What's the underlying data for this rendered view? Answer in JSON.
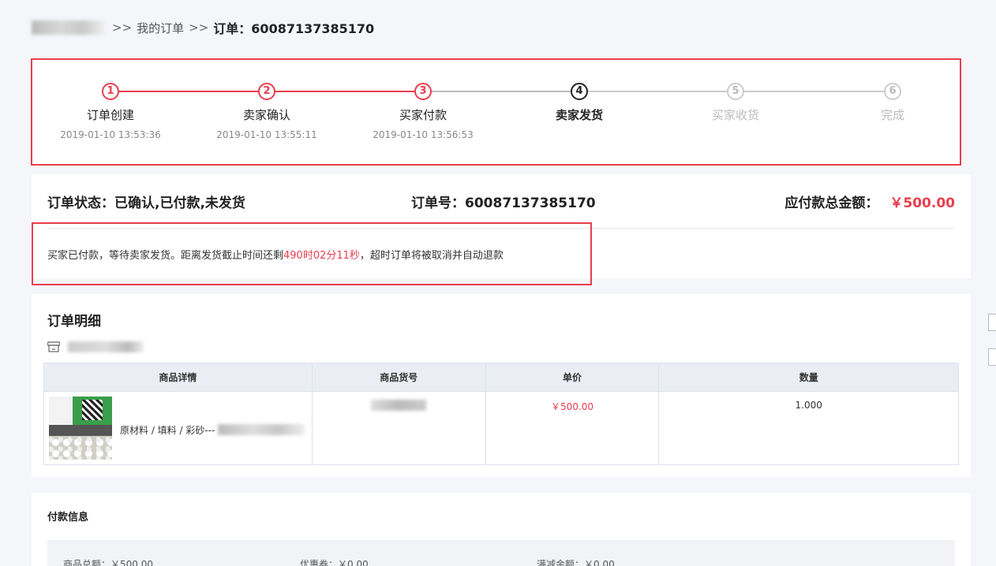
{
  "breadcrumb": {
    "my_orders": "我的订单",
    "sep": ">>",
    "current": "订单：60087137385170"
  },
  "steps": [
    {
      "num": "1",
      "label": "订单创建",
      "time": "2019-01-10 13:53:36",
      "state": "done"
    },
    {
      "num": "2",
      "label": "卖家确认",
      "time": "2019-01-10 13:55:11",
      "state": "done"
    },
    {
      "num": "3",
      "label": "买家付款",
      "time": "2019-01-10 13:56:53",
      "state": "done"
    },
    {
      "num": "4",
      "label": "卖家发货",
      "time": "",
      "state": "current"
    },
    {
      "num": "5",
      "label": "买家收货",
      "time": "",
      "state": "todo"
    },
    {
      "num": "6",
      "label": "完成",
      "time": "",
      "state": "todo"
    }
  ],
  "status": {
    "order_status": "订单状态：已确认,已付款,未发货",
    "order_no": "订单号：60087137385170",
    "total_label": "应付款总金额：",
    "total_amount": "￥500.00",
    "notice_prefix": "买家已付款，等待卖家发货。距离发货截止时间还剩",
    "countdown": "490时02分11秒",
    "notice_suffix": "，超时订单将被取消并自动退款"
  },
  "detail": {
    "title": "订单明细",
    "columns": [
      "商品详情",
      "商品货号",
      "单价",
      "数量"
    ],
    "rows": [
      {
        "name": "原材料 / 填料 / 彩砂---",
        "price": "￥500.00",
        "qty": "1.000"
      }
    ]
  },
  "payment": {
    "title": "付款信息",
    "items": [
      {
        "label": "商品总额：￥500.00"
      },
      {
        "label": "优惠券：￥0.00"
      },
      {
        "label": "满减金额：￥0.00"
      }
    ]
  },
  "colors": {
    "accent": "#e83e4e",
    "outline": "#e83e4e"
  }
}
